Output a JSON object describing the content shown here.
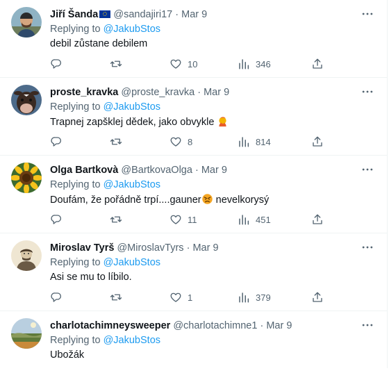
{
  "tweets": [
    {
      "name": "Jiří Šanda",
      "handle": "@sandajiri17",
      "separator": "·",
      "date": "Mar 9",
      "replying_prefix": "Replying to",
      "replying_to": "@JakubStos",
      "text": "debil zůstane debilem",
      "replies": "",
      "retweets": "",
      "likes": "10",
      "views": "346"
    },
    {
      "name": "proste_kravka",
      "handle": "@proste_kravka",
      "separator": "·",
      "date": "Mar 9",
      "replying_prefix": "Replying to",
      "replying_to": "@JakubStos",
      "text": "Trapnej zapšklej dědek, jako obvykle",
      "replies": "",
      "retweets": "",
      "likes": "8",
      "views": "814"
    },
    {
      "name": "Olga Bartkovà",
      "handle": "@BartkovaOlga",
      "separator": "·",
      "date": "Mar 9",
      "replying_prefix": "Replying to",
      "replying_to": "@JakubStos",
      "text_before": "Doufám, že pořádně trpí....gauner",
      "text_after": " nevelkorysý",
      "replies": "",
      "retweets": "",
      "likes": "11",
      "views": "451"
    },
    {
      "name": "Miroslav Tyrš",
      "handle": "@MiroslavTyrs",
      "separator": "·",
      "date": "Mar 9",
      "replying_prefix": "Replying to",
      "replying_to": "@JakubStos",
      "text": "Asi se mu to líbilo.",
      "replies": "",
      "retweets": "",
      "likes": "1",
      "views": "379"
    },
    {
      "name": "charlotachimneysweeper",
      "handle": "@charlotachimne1",
      "separator": "·",
      "date": "Mar 9",
      "replying_prefix": "Replying to",
      "replying_to": "@JakubStos",
      "text": "Ubožák"
    }
  ],
  "icons": {
    "reply": "reply-icon",
    "retweet": "retweet-icon",
    "like": "heart-icon",
    "views": "views-icon",
    "share": "share-icon",
    "more": "more-icon"
  },
  "colors": {
    "link": "#1d9bf0",
    "secondary_text": "#536471",
    "primary_text": "#0f1419",
    "divider": "#eff3f4"
  }
}
